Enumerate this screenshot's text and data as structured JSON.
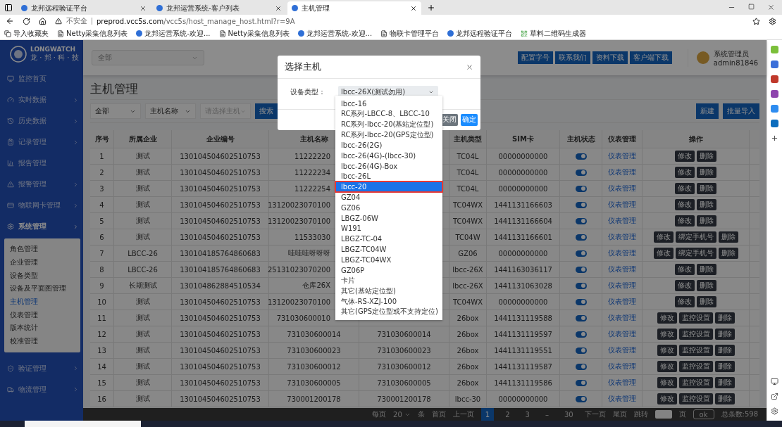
{
  "browser": {
    "tabs": [
      {
        "title": "龙邦远程验证平台",
        "selected": false
      },
      {
        "title": "龙邦运营系统-客户列表",
        "selected": false
      },
      {
        "title": "主机管理",
        "selected": true
      }
    ],
    "address": {
      "security": "不安全",
      "url_host": "preprod.vcc5s.com",
      "url_path": "/vcc5s/host_manage_host.html?r=9A"
    },
    "bookmarks": [
      {
        "label": "导入收藏夹",
        "kind": "import"
      },
      {
        "label": "Netty采集信息列表",
        "kind": "page"
      },
      {
        "label": "龙邦运营系统-欢迎...",
        "kind": "site"
      },
      {
        "label": "Netty采集信息列表",
        "kind": "page"
      },
      {
        "label": "龙邦运营系统-欢迎...",
        "kind": "site"
      },
      {
        "label": "物联卡管理平台",
        "kind": "page"
      },
      {
        "label": "龙邦远程验证平台",
        "kind": "site"
      },
      {
        "label": "草料二维码生成器",
        "kind": "qr"
      }
    ]
  },
  "app": {
    "logo": {
      "name": "LONGWATCH",
      "sub": "龙 · 邦 · 科 · 技"
    },
    "sidebar": [
      {
        "label": "监控首页",
        "expandable": false
      },
      {
        "label": "实时数据",
        "expandable": true
      },
      {
        "label": "历史数据",
        "expandable": true
      },
      {
        "label": "记录管理",
        "expandable": true
      },
      {
        "label": "报告管理",
        "expandable": false
      },
      {
        "label": "报警管理",
        "expandable": true
      },
      {
        "label": "物联网卡管理",
        "expandable": true
      },
      {
        "label": "系统管理",
        "expandable": true,
        "expanded": true,
        "children": [
          {
            "label": "角色管理",
            "selected": false
          },
          {
            "label": "企业管理",
            "selected": false
          },
          {
            "label": "设备类型",
            "selected": false
          },
          {
            "label": "设备及平面图管理",
            "selected": false
          },
          {
            "label": "主机管理",
            "selected": true
          },
          {
            "label": "仪表管理",
            "selected": false
          },
          {
            "label": "版本统计",
            "selected": false
          },
          {
            "label": "校准管理",
            "selected": false
          }
        ]
      },
      {
        "label": "验证管理",
        "expandable": true
      },
      {
        "label": "物流管理",
        "expandable": true
      }
    ],
    "top_select": "全部",
    "header_buttons": [
      "配置字号",
      "联系我们",
      "资料下载",
      "客户端下载"
    ],
    "user": {
      "role": "系统管理员",
      "account": "admin81846"
    },
    "page_title": "主机管理",
    "filters": [
      {
        "value": "全部"
      },
      {
        "value": "主机名称"
      },
      {
        "placeholder": "请选择主机"
      }
    ],
    "search_button": "搜索",
    "action_buttons": [
      "新建",
      "批量导入"
    ],
    "table": {
      "columns": [
        "序号",
        "所属企业",
        "企业编号",
        "主机名称",
        "主机类型",
        "SIM卡",
        "主机状态",
        "仪表管理",
        "操作"
      ],
      "rows": [
        {
          "no": "1",
          "company": "测试",
          "code": "130104504602510753",
          "host_name": "11222220",
          "type": "TC04L",
          "sim": "00000000000",
          "on": true,
          "meter": "仪表管理",
          "actions": [
            "修改",
            "删除"
          ]
        },
        {
          "no": "2",
          "company": "测试",
          "code": "130104504602510753",
          "host_name": "11222234",
          "type": "TC04L",
          "sim": "00000000000",
          "on": true,
          "meter": "仪表管理",
          "actions": [
            "修改",
            "删除"
          ]
        },
        {
          "no": "3",
          "company": "测试",
          "code": "130104504602510753",
          "host_name": "11222254",
          "type": "TC04L",
          "sim": "00000000000",
          "on": true,
          "meter": "仪表管理",
          "actions": [
            "修改",
            "删除"
          ]
        },
        {
          "no": "4",
          "company": "测试",
          "code": "130104504602510753",
          "host_name": "13120023070100",
          "type": "TC04WX",
          "sim": "1441131166603",
          "on": true,
          "meter": "仪表管理",
          "actions": [
            "修改",
            "删除"
          ]
        },
        {
          "no": "5",
          "company": "测试",
          "code": "130104504602510753",
          "host_name": "13120023070100",
          "type": "TC04WX",
          "sim": "1441131166604",
          "on": true,
          "meter": "仪表管理",
          "actions": [
            "修改",
            "删除"
          ]
        },
        {
          "no": "6",
          "company": "测试",
          "code": "130104504602510753",
          "host_name": "11533030",
          "type": "TC04W",
          "sim": "1441131166601",
          "on": true,
          "meter": "仪表管理",
          "actions": [
            "修改",
            "绑定手机号",
            "删除"
          ]
        },
        {
          "no": "7",
          "company": "LBCC-26",
          "code": "130104185764860683",
          "host_name": "哇哇哇呀呀呀",
          "type": "GZ06",
          "sim": "00000000000",
          "on": true,
          "meter": "仪表管理",
          "actions": [
            "修改",
            "绑定手机号",
            "删除"
          ]
        },
        {
          "no": "8",
          "company": "LBCC-26",
          "code": "130104185764860683",
          "host_name": "25131023070200",
          "type": "lbcc-26X",
          "sim": "1441163036117",
          "on": true,
          "meter": "仪表管理",
          "actions": [
            "修改",
            "删除"
          ]
        },
        {
          "no": "9",
          "company": "长期测试",
          "code": "130104862884510534",
          "host_name": "仓库26X",
          "type": "lbcc-26X",
          "sim": "1441131063028",
          "on": true,
          "meter": "仪表管理",
          "actions": [
            "修改",
            "删除"
          ]
        },
        {
          "no": "10",
          "company": "测试",
          "code": "130104504602510753",
          "host_name": "13120023070100",
          "type": "TC04WX",
          "sim": "00000000000",
          "on": true,
          "meter": "仪表管理",
          "actions": [
            "修改",
            "删除"
          ]
        },
        {
          "no": "11",
          "company": "测试",
          "code": "130104504602510753",
          "host_name": "731030600010",
          "type": "26box",
          "sim": "1441131119588",
          "on": true,
          "meter": "仪表管理",
          "actions": [
            "修改",
            "监控设置",
            "删除"
          ]
        },
        {
          "no": "12",
          "company": "测试",
          "code": "130104504602510753",
          "host_name": "731030600014",
          "column_6": "731030600014",
          "type": "26box",
          "sim": "1441131119597",
          "on": true,
          "meter": "仪表管理",
          "actions": [
            "修改",
            "监控设置",
            "删除"
          ]
        },
        {
          "no": "13",
          "company": "测试",
          "code": "130104504602510753",
          "host_name": "731030600023",
          "column_6": "731030600023",
          "type": "26box",
          "sim": "1441131119551",
          "on": true,
          "meter": "仪表管理",
          "actions": [
            "修改",
            "监控设置",
            "删除"
          ]
        },
        {
          "no": "14",
          "company": "测试",
          "code": "130104504602510753",
          "host_name": "731030600012",
          "column_6": "731030600012",
          "type": "26box",
          "sim": "1441131119587",
          "on": true,
          "meter": "仪表管理",
          "actions": [
            "修改",
            "监控设置",
            "删除"
          ]
        },
        {
          "no": "15",
          "company": "测试",
          "code": "130104504602510753",
          "host_name": "731030600005",
          "column_6": "731030600005",
          "type": "26box",
          "sim": "1441131119586",
          "on": true,
          "meter": "仪表管理",
          "actions": [
            "修改",
            "监控设置",
            "删除"
          ]
        },
        {
          "no": "16",
          "company": "测试",
          "code": "130104504602510753",
          "host_name": "730001200178",
          "column_6": "730001200178",
          "type": "lbcc-30",
          "sim": "00000000000",
          "on": true,
          "meter": "仪表管理",
          "actions": [
            "修改",
            "监控设置",
            "删除"
          ]
        }
      ]
    },
    "pagination": {
      "per_page_label": "每页",
      "per_page": "20",
      "unit": "条",
      "first": "首页",
      "prev": "上一页",
      "pages": [
        {
          "label": "1",
          "selected": true
        },
        {
          "label": "2",
          "selected": false
        },
        {
          "label": "3",
          "selected": false
        },
        {
          "label": "–",
          "selected": false
        },
        {
          "label": "30",
          "selected": false
        }
      ],
      "next": "下一页",
      "last": "尾页",
      "jump": "跳转",
      "page_unit": "页",
      "ok": "ok",
      "total": "总条数:598"
    }
  },
  "dialog": {
    "title": "选择主机",
    "label": "设备类型：",
    "select_value": "lbcc-26X(测试勿用)",
    "buttons": [
      {
        "label": "关闭",
        "kind": "secondary"
      },
      {
        "label": "确定",
        "kind": "primary"
      }
    ],
    "options": [
      {
        "label": "lbcc-16",
        "selected": false
      },
      {
        "label": "RC系列-LBCC-8、LBCC-10",
        "selected": false
      },
      {
        "label": "RC系列-lbcc-20(基站定位型)",
        "selected": false
      },
      {
        "label": "RC系列-lbcc-20(GPS定位型)",
        "selected": false
      },
      {
        "label": "lbcc-26(2G)",
        "selected": false
      },
      {
        "label": "lbcc-26(4G)-(lbcc-30)",
        "selected": false
      },
      {
        "label": "lbcc-26(4G)-Box",
        "selected": false
      },
      {
        "label": "lbcc-26L",
        "selected": false
      },
      {
        "label": "lbcc-20",
        "selected": true
      },
      {
        "label": "GZ04",
        "selected": false
      },
      {
        "label": "GZ06",
        "selected": false
      },
      {
        "label": "LBGZ-06W",
        "selected": false
      },
      {
        "label": "W191",
        "selected": false
      },
      {
        "label": "LBGZ-TC-04",
        "selected": false
      },
      {
        "label": "LBGZ-TC04W",
        "selected": false
      },
      {
        "label": "LBGZ-TC04WX",
        "selected": false
      },
      {
        "label": "GZ06P",
        "selected": false
      },
      {
        "label": "卡片",
        "selected": false
      },
      {
        "label": "其它(基站定位型)",
        "selected": false
      },
      {
        "label": "气体-RS-XZJ-100",
        "selected": false
      },
      {
        "label": "其它(GPS定位型或不支持定位)",
        "selected": false
      }
    ]
  }
}
